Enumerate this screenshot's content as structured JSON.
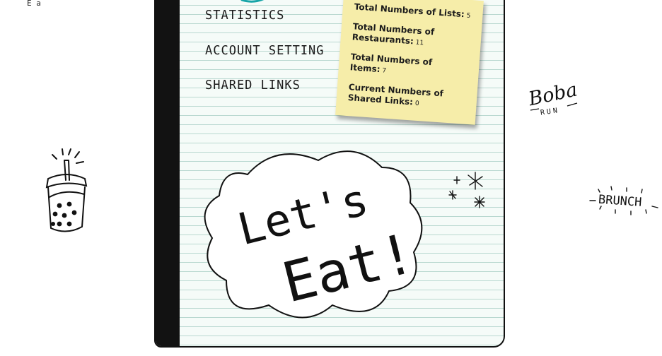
{
  "menu": {
    "statistics": "STATISTICS",
    "account_setting": "ACCOUNT SETTING",
    "shared_links": "SHARED LINKS"
  },
  "stats": {
    "lists_label": "Total Numbers of Lists:",
    "lists_value": "5",
    "restaurants_label": "Total Numbers of Restaurants:",
    "restaurants_value": "11",
    "items_label": "Total Numbers of Items:",
    "items_value": "7",
    "shared_label": "Current Numbers of Shared Links:",
    "shared_value": "0"
  },
  "hero": {
    "line1": "Let's",
    "line2": "Eat!"
  },
  "doodles": {
    "boba": "Boba",
    "run": "RUN",
    "brunch": "BRUNCH",
    "corner": "E a"
  },
  "colors": {
    "accent": "#17a5a8",
    "note": "#f6eda9",
    "lines": "#b9d8d0"
  }
}
